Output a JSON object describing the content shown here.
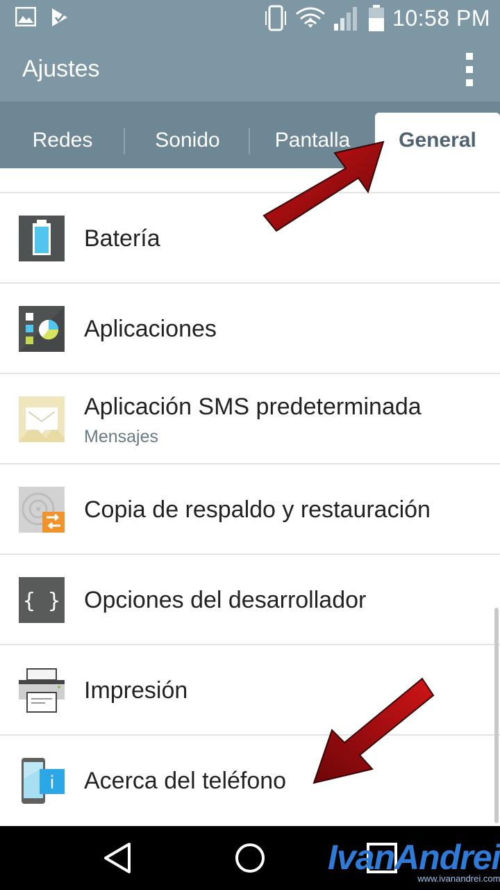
{
  "status_bar": {
    "time": "10:58 PM",
    "icons": [
      "image-icon",
      "check-app-icon",
      "vibrate-icon",
      "wifi-icon",
      "signal-icon",
      "battery-icon"
    ]
  },
  "app_bar": {
    "title": "Ajustes",
    "menu_icon": "overflow-menu-icon"
  },
  "tabs": [
    {
      "label": "Redes",
      "active": false
    },
    {
      "label": "Sonido",
      "active": false
    },
    {
      "label": "Pantalla",
      "active": false
    },
    {
      "label": "General",
      "active": true
    }
  ],
  "settings": [
    {
      "title": "Batería",
      "icon": "battery-settings-icon"
    },
    {
      "title": "Aplicaciones",
      "icon": "apps-icon"
    },
    {
      "title": "Aplicación SMS predeterminada",
      "subtitle": "Mensajes",
      "icon": "sms-icon"
    },
    {
      "title": "Copia de respaldo y restauración",
      "icon": "backup-icon"
    },
    {
      "title": "Opciones del desarrollador",
      "icon": "developer-icon"
    },
    {
      "title": "Impresión",
      "icon": "printer-icon"
    },
    {
      "title": "Acerca del teléfono",
      "icon": "about-phone-icon"
    }
  ],
  "nav_bar": {
    "buttons": [
      "back",
      "home",
      "recents"
    ]
  },
  "watermark": {
    "name": "IvanAndrei",
    "url": "www.ivanandrei.com"
  },
  "colors": {
    "app_bar": "#7d97a4",
    "tab_bar": "#6e8794",
    "arrow": "#a10f12"
  }
}
